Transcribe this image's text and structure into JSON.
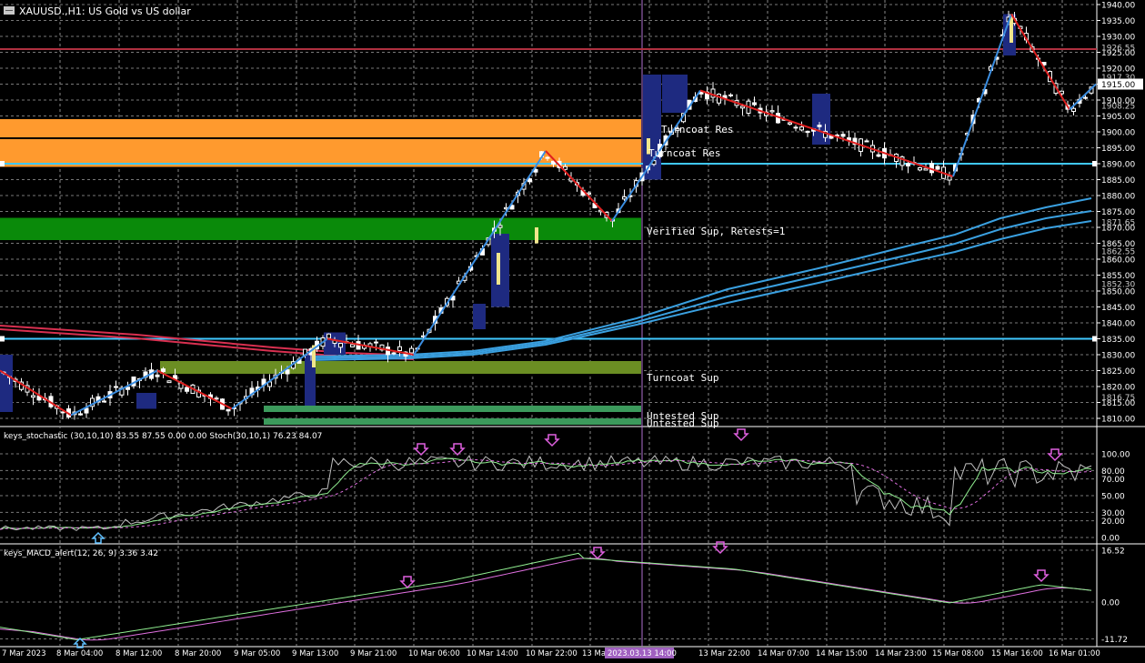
{
  "window": {
    "symbol_title": "XAUUSD.,H1: US Gold vs US dollar"
  },
  "chart_data": [
    {
      "type": "candlestick",
      "panel": "main",
      "title": "XAUUSD.,H1: US Gold vs US dollar",
      "ylim": [
        1807,
        1942
      ],
      "y_ticks": [
        1940.0,
        1935.0,
        1930.0,
        1925.0,
        1920.0,
        1915.0,
        1910.0,
        1905.0,
        1900.0,
        1895.0,
        1890.0,
        1885.0,
        1880.0,
        1875.0,
        1870.0,
        1865.0,
        1860.0,
        1855.0,
        1850.0,
        1845.0,
        1840.0,
        1835.0,
        1830.0,
        1825.0,
        1820.0,
        1815.0,
        1810.0
      ],
      "y_tick_labels": [
        "1940.00",
        "1935.00",
        "1930.00",
        "1925.00",
        "1920.00",
        "1915.00",
        "1910.00",
        "1905.00",
        "1900.00",
        "1895.00",
        "1890.00",
        "1885.00",
        "1880.00",
        "1875.00",
        "1870.00",
        "1865.00",
        "1860.00",
        "1855.00",
        "1850.00",
        "1845.00",
        "1840.00",
        "1835.00",
        "1830.00",
        "1825.00",
        "1820.00",
        "1815.00",
        "1810.00"
      ],
      "overlapping_price_labels": [
        "1926.55",
        "1917.30",
        "1908.25",
        "1871.65",
        "1862.55",
        "1852.30",
        "1816.75"
      ],
      "current_price_label": "1915.00",
      "zones": [
        {
          "label": "Turncoat Res",
          "from": 1896,
          "to": 1904,
          "color": "#ff9a2e"
        },
        {
          "label": "Turncoat Res",
          "from": 1889,
          "to": 1896,
          "color": "#ff9a2e"
        },
        {
          "label": "Verified Sup, Retests=1",
          "from": 1866,
          "to": 1873,
          "color": "#0a8a0a"
        },
        {
          "label": "Turncoat Sup",
          "from": 1824,
          "to": 1828,
          "color": "#6b8e23"
        },
        {
          "label": "Untested Sup",
          "from": 1812,
          "to": 1814,
          "color": "#3c9a5c"
        },
        {
          "label": "Untested Sup",
          "from": 1808,
          "to": 1810,
          "color": "#3c9a5c"
        }
      ],
      "horizontal_lines": [
        {
          "price": 1898,
          "color": "#000000"
        },
        {
          "price": 1890,
          "color": "#40c8ff"
        },
        {
          "price": 1835,
          "color": "#40c8ff"
        },
        {
          "price": 1926,
          "color": "#b03040"
        }
      ],
      "zigzag": [
        {
          "x": 0,
          "y": 1825,
          "c": "red"
        },
        {
          "x": 78,
          "y": 1811,
          "c": "blue"
        },
        {
          "x": 173,
          "y": 1825,
          "c": "red"
        },
        {
          "x": 255,
          "y": 1813,
          "c": "blue"
        },
        {
          "x": 360,
          "y": 1835,
          "c": "red"
        },
        {
          "x": 455,
          "y": 1830,
          "c": "blue"
        },
        {
          "x": 600,
          "y": 1894,
          "c": "red"
        },
        {
          "x": 673,
          "y": 1872,
          "c": "blue"
        },
        {
          "x": 770,
          "y": 1913,
          "c": "red"
        },
        {
          "x": 1048,
          "y": 1886,
          "c": "blue"
        },
        {
          "x": 1112,
          "y": 1937,
          "c": "red"
        },
        {
          "x": 1176,
          "y": 1907,
          "c": "blue"
        },
        {
          "x": 1205,
          "y": 1915,
          "c": "blue"
        }
      ],
      "x_labels": [
        "7 Mar 2023",
        "8 Mar 04:00",
        "8 Mar 12:00",
        "8 Mar 20:00",
        "9 Mar 05:00",
        "9 Mar 13:00",
        "9 Mar 21:00",
        "10 Mar 06:00",
        "10 Mar 14:00",
        "10 Mar 22:00",
        "13 Mar",
        "2023.03.13 14:00",
        "13 Mar 22:00",
        "14 Mar 07:00",
        "14 Mar 15:00",
        "14 Mar 23:00",
        "15 Mar 08:00",
        "15 Mar 16:00",
        "16 Mar 01:00"
      ]
    },
    {
      "type": "line",
      "panel": "stochastic",
      "title": "keys_stochastic (30,10,10) 83.55 87.55 0.00 0.00 Stoch(30,10,1) 76.23 84.07",
      "ylim": [
        0,
        100
      ],
      "y_tick_labels": [
        "100.00",
        "80.00",
        "70.00",
        "50.00",
        "30.00",
        "20.00",
        "0.00"
      ]
    },
    {
      "type": "line",
      "panel": "macd",
      "title": "keys_MACD_alert(12, 26, 9) 3.36 3.42",
      "ylim": [
        -11.72,
        16.52
      ],
      "y_tick_labels": [
        "16.52",
        "0.00",
        "-11.72"
      ]
    }
  ]
}
